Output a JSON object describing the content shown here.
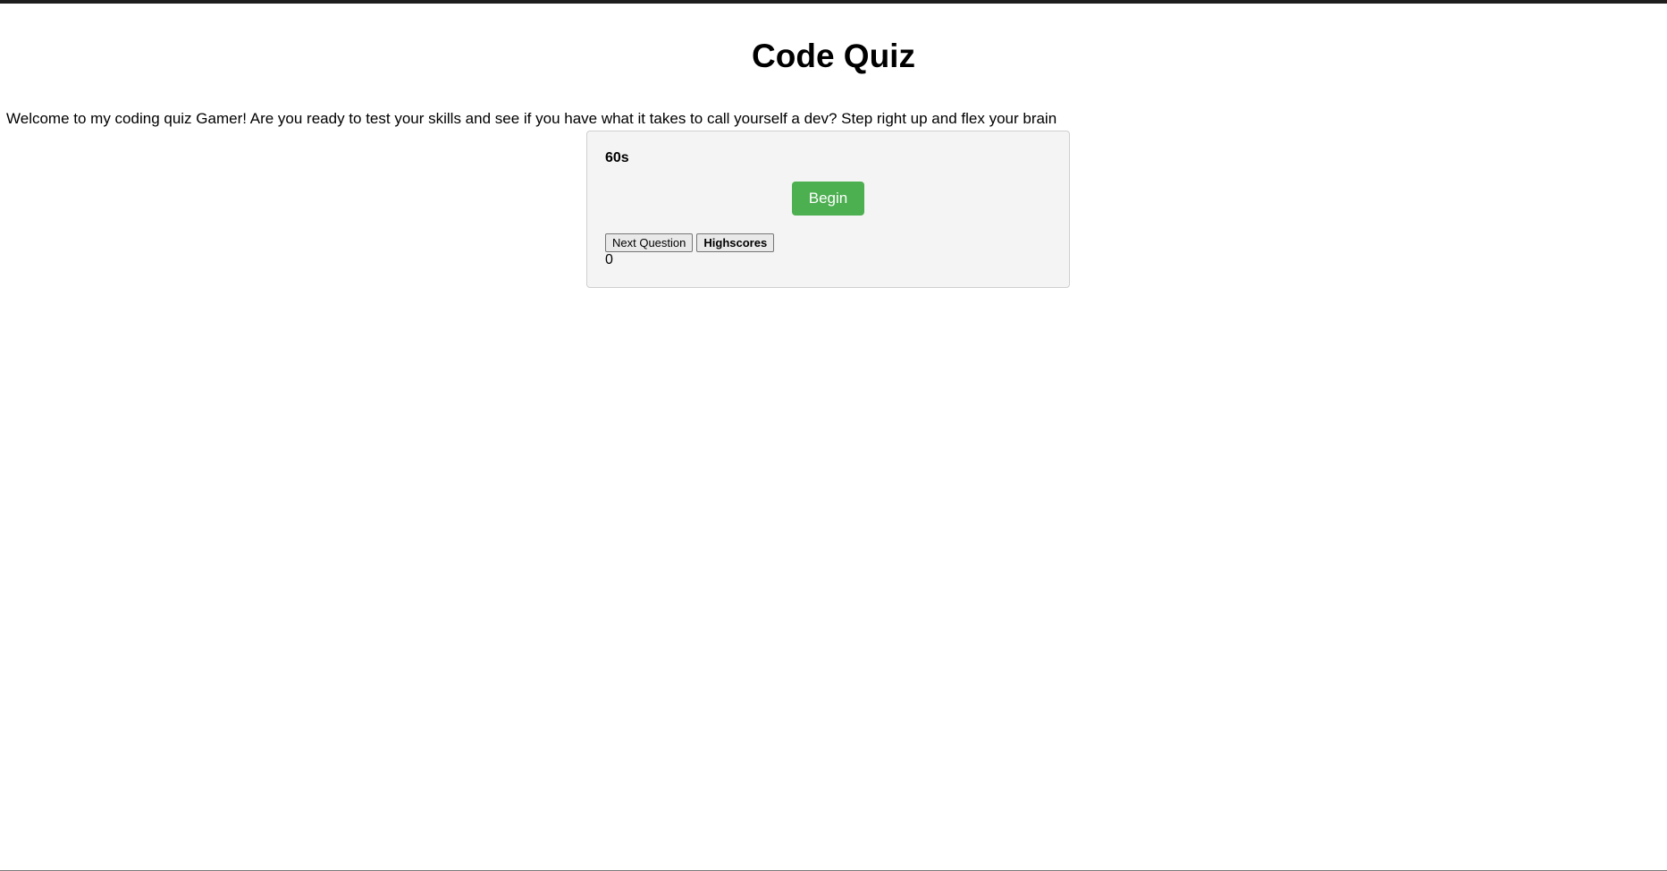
{
  "header": {
    "title": "Code Quiz",
    "intro": "Welcome to my coding quiz Gamer! Are you ready to test your skills and see if you have what it takes to call yourself a dev? Step right up and flex your brain"
  },
  "quiz": {
    "timer": "60s",
    "begin_label": "Begin",
    "next_question_label": "Next Question",
    "highscores_label": "Highscores",
    "score": "0"
  },
  "colors": {
    "begin_button": "#4caf50",
    "card_background": "#f4f4f4"
  }
}
